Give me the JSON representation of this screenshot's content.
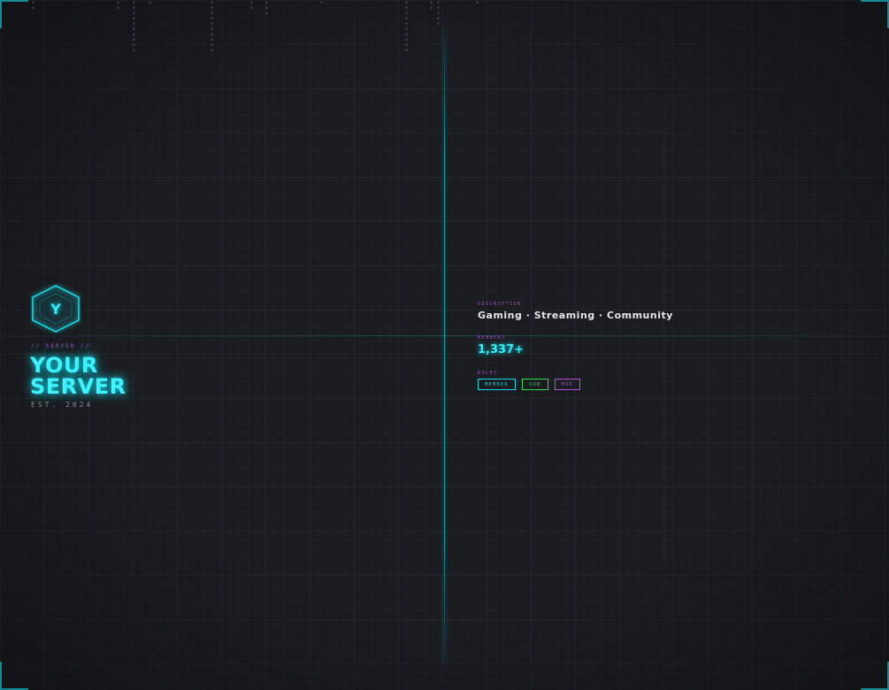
{
  "server": {
    "icon_letter": "Y",
    "overline": "// SERVER //",
    "title_line1": "YOUR",
    "title_line2": "SERVER",
    "established": "EST. 2024"
  },
  "details": {
    "description_label": "DESCRIPTION",
    "description": "Gaming · Streaming · Community",
    "members_label": "MEMBERS",
    "members": "1,337+",
    "roles_label": "ROLES",
    "roles": [
      {
        "label": "MEMBER",
        "color": "#14d8e6"
      },
      {
        "label": "SUB",
        "color": "#2bd94a"
      },
      {
        "label": "MOD",
        "color": "#b04fe0"
      }
    ]
  },
  "colors": {
    "background": "#1b1c20",
    "accent_cyan": "#14d8e6",
    "accent_purple": "#a04fd0",
    "text_light": "#e6e6ea",
    "text_muted": "#8a8c94"
  }
}
